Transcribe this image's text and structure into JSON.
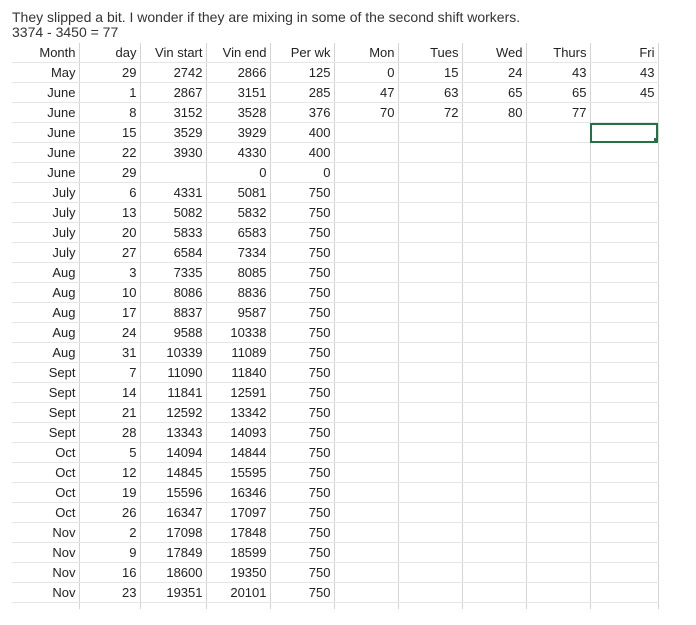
{
  "intro": {
    "line1": "They slipped a bit. I wonder if they are mixing in some of the second shift workers.",
    "line2": "3374 - 3450 = 77"
  },
  "sheet": {
    "headers": [
      "Month",
      "day",
      "Vin start",
      "Vin end",
      "Per wk",
      "Mon",
      "Tues",
      "Wed",
      "Thurs",
      "Fri"
    ],
    "rows": [
      [
        "May",
        "29",
        "2742",
        "2866",
        "125",
        "0",
        "15",
        "24",
        "43",
        "43"
      ],
      [
        "June",
        "1",
        "2867",
        "3151",
        "285",
        "47",
        "63",
        "65",
        "65",
        "45"
      ],
      [
        "June",
        "8",
        "3152",
        "3528",
        "376",
        "70",
        "72",
        "80",
        "77",
        ""
      ],
      [
        "June",
        "15",
        "3529",
        "3929",
        "400",
        "",
        "",
        "",
        "",
        ""
      ],
      [
        "June",
        "22",
        "3930",
        "4330",
        "400",
        "",
        "",
        "",
        "",
        ""
      ],
      [
        "June",
        "29",
        "",
        "0",
        "0",
        "",
        "",
        "",
        "",
        ""
      ],
      [
        "July",
        "6",
        "4331",
        "5081",
        "750",
        "",
        "",
        "",
        "",
        ""
      ],
      [
        "July",
        "13",
        "5082",
        "5832",
        "750",
        "",
        "",
        "",
        "",
        ""
      ],
      [
        "July",
        "20",
        "5833",
        "6583",
        "750",
        "",
        "",
        "",
        "",
        ""
      ],
      [
        "July",
        "27",
        "6584",
        "7334",
        "750",
        "",
        "",
        "",
        "",
        ""
      ],
      [
        "Aug",
        "3",
        "7335",
        "8085",
        "750",
        "",
        "",
        "",
        "",
        ""
      ],
      [
        "Aug",
        "10",
        "8086",
        "8836",
        "750",
        "",
        "",
        "",
        "",
        ""
      ],
      [
        "Aug",
        "17",
        "8837",
        "9587",
        "750",
        "",
        "",
        "",
        "",
        ""
      ],
      [
        "Aug",
        "24",
        "9588",
        "10338",
        "750",
        "",
        "",
        "",
        "",
        ""
      ],
      [
        "Aug",
        "31",
        "10339",
        "11089",
        "750",
        "",
        "",
        "",
        "",
        ""
      ],
      [
        "Sept",
        "7",
        "11090",
        "11840",
        "750",
        "",
        "",
        "",
        "",
        ""
      ],
      [
        "Sept",
        "14",
        "11841",
        "12591",
        "750",
        "",
        "",
        "",
        "",
        ""
      ],
      [
        "Sept",
        "21",
        "12592",
        "13342",
        "750",
        "",
        "",
        "",
        "",
        ""
      ],
      [
        "Sept",
        "28",
        "13343",
        "14093",
        "750",
        "",
        "",
        "",
        "",
        ""
      ],
      [
        "Oct",
        "5",
        "14094",
        "14844",
        "750",
        "",
        "",
        "",
        "",
        ""
      ],
      [
        "Oct",
        "12",
        "14845",
        "15595",
        "750",
        "",
        "",
        "",
        "",
        ""
      ],
      [
        "Oct",
        "19",
        "15596",
        "16346",
        "750",
        "",
        "",
        "",
        "",
        ""
      ],
      [
        "Oct",
        "26",
        "16347",
        "17097",
        "750",
        "",
        "",
        "",
        "",
        ""
      ],
      [
        "Nov",
        "2",
        "17098",
        "17848",
        "750",
        "",
        "",
        "",
        "",
        ""
      ],
      [
        "Nov",
        "9",
        "17849",
        "18599",
        "750",
        "",
        "",
        "",
        "",
        ""
      ],
      [
        "Nov",
        "16",
        "18600",
        "19350",
        "750",
        "",
        "",
        "",
        "",
        ""
      ],
      [
        "Nov",
        "23",
        "19351",
        "20101",
        "750",
        "",
        "",
        "",
        "",
        ""
      ]
    ],
    "selected_cell": {
      "row": 3,
      "col": 9
    }
  },
  "colors": {
    "gridline": "#d4d4d4",
    "selection": "#217346"
  }
}
